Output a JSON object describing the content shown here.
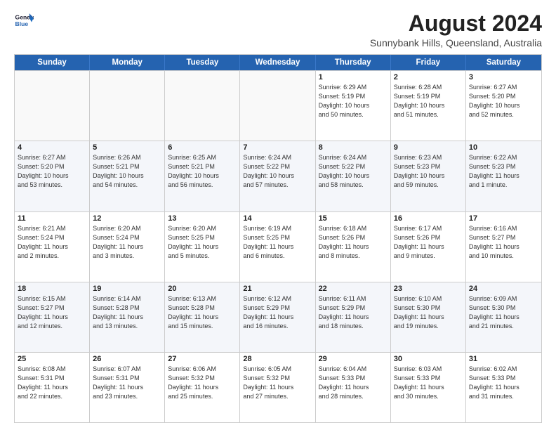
{
  "logo": {
    "line1": "General",
    "line2": "Blue"
  },
  "title": "August 2024",
  "subtitle": "Sunnybank Hills, Queensland, Australia",
  "header_days": [
    "Sunday",
    "Monday",
    "Tuesday",
    "Wednesday",
    "Thursday",
    "Friday",
    "Saturday"
  ],
  "rows": [
    [
      {
        "day": "",
        "info": "",
        "empty": true
      },
      {
        "day": "",
        "info": "",
        "empty": true
      },
      {
        "day": "",
        "info": "",
        "empty": true
      },
      {
        "day": "",
        "info": "",
        "empty": true
      },
      {
        "day": "1",
        "info": "Sunrise: 6:29 AM\nSunset: 5:19 PM\nDaylight: 10 hours\nand 50 minutes."
      },
      {
        "day": "2",
        "info": "Sunrise: 6:28 AM\nSunset: 5:19 PM\nDaylight: 10 hours\nand 51 minutes."
      },
      {
        "day": "3",
        "info": "Sunrise: 6:27 AM\nSunset: 5:20 PM\nDaylight: 10 hours\nand 52 minutes."
      }
    ],
    [
      {
        "day": "4",
        "info": "Sunrise: 6:27 AM\nSunset: 5:20 PM\nDaylight: 10 hours\nand 53 minutes."
      },
      {
        "day": "5",
        "info": "Sunrise: 6:26 AM\nSunset: 5:21 PM\nDaylight: 10 hours\nand 54 minutes."
      },
      {
        "day": "6",
        "info": "Sunrise: 6:25 AM\nSunset: 5:21 PM\nDaylight: 10 hours\nand 56 minutes."
      },
      {
        "day": "7",
        "info": "Sunrise: 6:24 AM\nSunset: 5:22 PM\nDaylight: 10 hours\nand 57 minutes."
      },
      {
        "day": "8",
        "info": "Sunrise: 6:24 AM\nSunset: 5:22 PM\nDaylight: 10 hours\nand 58 minutes."
      },
      {
        "day": "9",
        "info": "Sunrise: 6:23 AM\nSunset: 5:23 PM\nDaylight: 10 hours\nand 59 minutes."
      },
      {
        "day": "10",
        "info": "Sunrise: 6:22 AM\nSunset: 5:23 PM\nDaylight: 11 hours\nand 1 minute."
      }
    ],
    [
      {
        "day": "11",
        "info": "Sunrise: 6:21 AM\nSunset: 5:24 PM\nDaylight: 11 hours\nand 2 minutes."
      },
      {
        "day": "12",
        "info": "Sunrise: 6:20 AM\nSunset: 5:24 PM\nDaylight: 11 hours\nand 3 minutes."
      },
      {
        "day": "13",
        "info": "Sunrise: 6:20 AM\nSunset: 5:25 PM\nDaylight: 11 hours\nand 5 minutes."
      },
      {
        "day": "14",
        "info": "Sunrise: 6:19 AM\nSunset: 5:25 PM\nDaylight: 11 hours\nand 6 minutes."
      },
      {
        "day": "15",
        "info": "Sunrise: 6:18 AM\nSunset: 5:26 PM\nDaylight: 11 hours\nand 8 minutes."
      },
      {
        "day": "16",
        "info": "Sunrise: 6:17 AM\nSunset: 5:26 PM\nDaylight: 11 hours\nand 9 minutes."
      },
      {
        "day": "17",
        "info": "Sunrise: 6:16 AM\nSunset: 5:27 PM\nDaylight: 11 hours\nand 10 minutes."
      }
    ],
    [
      {
        "day": "18",
        "info": "Sunrise: 6:15 AM\nSunset: 5:27 PM\nDaylight: 11 hours\nand 12 minutes."
      },
      {
        "day": "19",
        "info": "Sunrise: 6:14 AM\nSunset: 5:28 PM\nDaylight: 11 hours\nand 13 minutes."
      },
      {
        "day": "20",
        "info": "Sunrise: 6:13 AM\nSunset: 5:28 PM\nDaylight: 11 hours\nand 15 minutes."
      },
      {
        "day": "21",
        "info": "Sunrise: 6:12 AM\nSunset: 5:29 PM\nDaylight: 11 hours\nand 16 minutes."
      },
      {
        "day": "22",
        "info": "Sunrise: 6:11 AM\nSunset: 5:29 PM\nDaylight: 11 hours\nand 18 minutes."
      },
      {
        "day": "23",
        "info": "Sunrise: 6:10 AM\nSunset: 5:30 PM\nDaylight: 11 hours\nand 19 minutes."
      },
      {
        "day": "24",
        "info": "Sunrise: 6:09 AM\nSunset: 5:30 PM\nDaylight: 11 hours\nand 21 minutes."
      }
    ],
    [
      {
        "day": "25",
        "info": "Sunrise: 6:08 AM\nSunset: 5:31 PM\nDaylight: 11 hours\nand 22 minutes."
      },
      {
        "day": "26",
        "info": "Sunrise: 6:07 AM\nSunset: 5:31 PM\nDaylight: 11 hours\nand 23 minutes."
      },
      {
        "day": "27",
        "info": "Sunrise: 6:06 AM\nSunset: 5:32 PM\nDaylight: 11 hours\nand 25 minutes."
      },
      {
        "day": "28",
        "info": "Sunrise: 6:05 AM\nSunset: 5:32 PM\nDaylight: 11 hours\nand 27 minutes."
      },
      {
        "day": "29",
        "info": "Sunrise: 6:04 AM\nSunset: 5:33 PM\nDaylight: 11 hours\nand 28 minutes."
      },
      {
        "day": "30",
        "info": "Sunrise: 6:03 AM\nSunset: 5:33 PM\nDaylight: 11 hours\nand 30 minutes."
      },
      {
        "day": "31",
        "info": "Sunrise: 6:02 AM\nSunset: 5:33 PM\nDaylight: 11 hours\nand 31 minutes."
      }
    ]
  ]
}
